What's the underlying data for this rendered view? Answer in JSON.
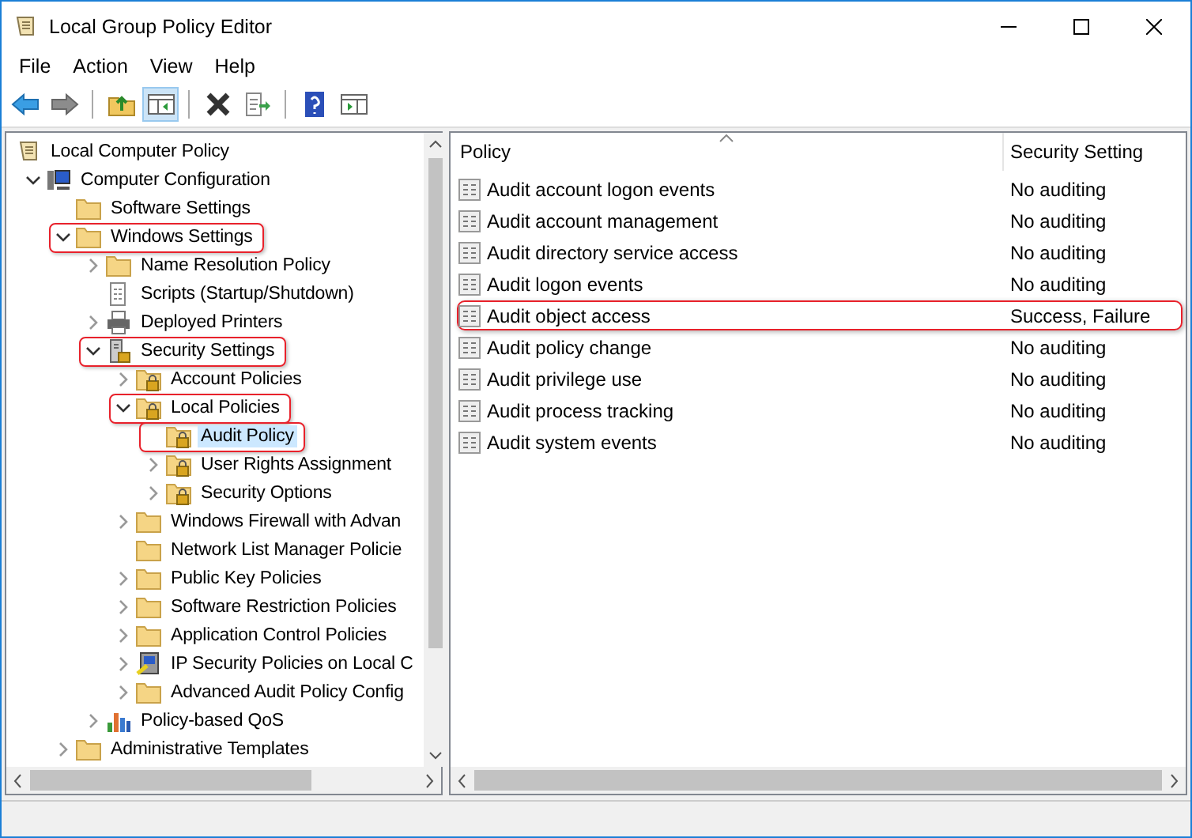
{
  "window": {
    "title": "Local Group Policy Editor"
  },
  "menu": [
    "File",
    "Action",
    "View",
    "Help"
  ],
  "toolbar": [
    {
      "kind": "back",
      "pressed": false
    },
    {
      "kind": "forward",
      "pressed": false
    },
    {
      "kind": "separator"
    },
    {
      "kind": "up",
      "pressed": false
    },
    {
      "kind": "tree",
      "pressed": true
    },
    {
      "kind": "separator"
    },
    {
      "kind": "delete",
      "pressed": false
    },
    {
      "kind": "export",
      "pressed": false
    },
    {
      "kind": "separator"
    },
    {
      "kind": "help",
      "pressed": false
    },
    {
      "kind": "actions",
      "pressed": false
    }
  ],
  "tree": [
    {
      "label": "Local Computer Policy",
      "kind": "scroll",
      "selected": false,
      "highlighted": false,
      "children": [
        {
          "label": "Computer Configuration",
          "kind": "computer",
          "expanded": true,
          "selected": false,
          "highlighted": false,
          "children": [
            {
              "label": "Software Settings",
              "kind": "folder",
              "selected": false,
              "highlighted": false
            },
            {
              "label": "Windows Settings",
              "kind": "folder",
              "expanded": true,
              "selected": false,
              "highlighted": true,
              "children": [
                {
                  "label": "Name Resolution Policy",
                  "kind": "folder",
                  "expanded": false,
                  "selected": false,
                  "highlighted": false
                },
                {
                  "label": "Scripts (Startup/Shutdown)",
                  "kind": "script",
                  "selected": false,
                  "highlighted": false
                },
                {
                  "label": "Deployed Printers",
                  "kind": "printer",
                  "expanded": false,
                  "selected": false,
                  "highlighted": false
                },
                {
                  "label": "Security Settings",
                  "kind": "security",
                  "expanded": true,
                  "selected": false,
                  "highlighted": true,
                  "children": [
                    {
                      "label": "Account Policies",
                      "kind": "lockfolder",
                      "expanded": false,
                      "selected": false,
                      "highlighted": false
                    },
                    {
                      "label": "Local Policies",
                      "kind": "lockfolder",
                      "expanded": true,
                      "selected": false,
                      "highlighted": true,
                      "children": [
                        {
                          "label": "Audit Policy",
                          "kind": "lockfolder",
                          "selected": true,
                          "highlighted": true
                        },
                        {
                          "label": "User Rights Assignment",
                          "kind": "lockfolder",
                          "expanded": false,
                          "selected": false,
                          "highlighted": false
                        },
                        {
                          "label": "Security Options",
                          "kind": "lockfolder",
                          "expanded": false,
                          "selected": false,
                          "highlighted": false
                        }
                      ]
                    },
                    {
                      "label": "Windows Firewall with Advan",
                      "kind": "folder",
                      "expanded": false,
                      "selected": false,
                      "highlighted": false
                    },
                    {
                      "label": "Network List Manager Policie",
                      "kind": "folder",
                      "selected": false,
                      "highlighted": false
                    },
                    {
                      "label": "Public Key Policies",
                      "kind": "folder",
                      "expanded": false,
                      "selected": false,
                      "highlighted": false
                    },
                    {
                      "label": "Software Restriction Policies",
                      "kind": "folder",
                      "expanded": false,
                      "selected": false,
                      "highlighted": false
                    },
                    {
                      "label": "Application Control Policies",
                      "kind": "folder",
                      "expanded": false,
                      "selected": false,
                      "highlighted": false
                    },
                    {
                      "label": "IP Security Policies on Local C",
                      "kind": "ipsec",
                      "expanded": false,
                      "selected": false,
                      "highlighted": false
                    },
                    {
                      "label": "Advanced Audit Policy Config",
                      "kind": "folder",
                      "expanded": false,
                      "selected": false,
                      "highlighted": false
                    }
                  ]
                },
                {
                  "label": "Policy-based QoS",
                  "kind": "qos",
                  "expanded": false,
                  "selected": false,
                  "highlighted": false
                }
              ]
            },
            {
              "label": "Administrative Templates",
              "kind": "folder",
              "expanded": false,
              "selected": false,
              "highlighted": false
            }
          ]
        }
      ]
    }
  ],
  "table": {
    "columns": [
      "Policy",
      "Security Setting"
    ],
    "rows": [
      {
        "policy": "Audit account logon events",
        "setting": "No auditing",
        "highlighted": false
      },
      {
        "policy": "Audit account management",
        "setting": "No auditing",
        "highlighted": false
      },
      {
        "policy": "Audit directory service access",
        "setting": "No auditing",
        "highlighted": false
      },
      {
        "policy": "Audit logon events",
        "setting": "No auditing",
        "highlighted": false
      },
      {
        "policy": "Audit object access",
        "setting": "Success, Failure",
        "highlighted": true
      },
      {
        "policy": "Audit policy change",
        "setting": "No auditing",
        "highlighted": false
      },
      {
        "policy": "Audit privilege use",
        "setting": "No auditing",
        "highlighted": false
      },
      {
        "policy": "Audit process tracking",
        "setting": "No auditing",
        "highlighted": false
      },
      {
        "policy": "Audit system events",
        "setting": "No auditing",
        "highlighted": false
      }
    ]
  }
}
